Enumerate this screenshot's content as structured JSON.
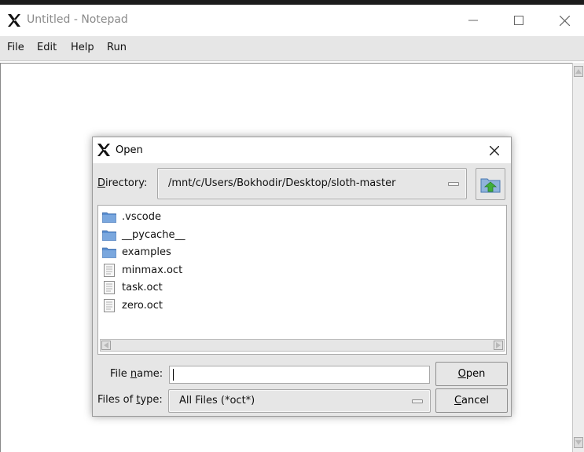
{
  "window": {
    "title": "Untitled - Notepad",
    "controls": {
      "minimize": "—",
      "maximize": "☐",
      "close": "✕"
    }
  },
  "menu": {
    "items": [
      "File",
      "Edit",
      "Help",
      "Run"
    ]
  },
  "dialog": {
    "title": "Open",
    "directory_label": "Directory:",
    "directory_value": "/mnt/c/Users/Bokhodir/Desktop/sloth-master",
    "files": [
      {
        "name": ".vscode",
        "type": "folder",
        "icon": "folder-icon"
      },
      {
        "name": "__pycache__",
        "type": "folder",
        "icon": "folder-icon"
      },
      {
        "name": "examples",
        "type": "folder",
        "icon": "folder-icon"
      },
      {
        "name": "minmax.oct",
        "type": "file",
        "icon": "file-icon"
      },
      {
        "name": "task.oct",
        "type": "file",
        "icon": "file-icon"
      },
      {
        "name": "zero.oct",
        "type": "file",
        "icon": "file-icon"
      }
    ],
    "filename_label": "File name:",
    "filename_value": "",
    "filetype_label": "Files of type:",
    "filetype_value": "All Files (*oct*)",
    "open_button": "Open",
    "cancel_button": "Cancel"
  },
  "colors": {
    "folder": "#5b8fd1",
    "up_arrow": "#3fae3a",
    "dialog_bg": "#e6e6e6"
  }
}
